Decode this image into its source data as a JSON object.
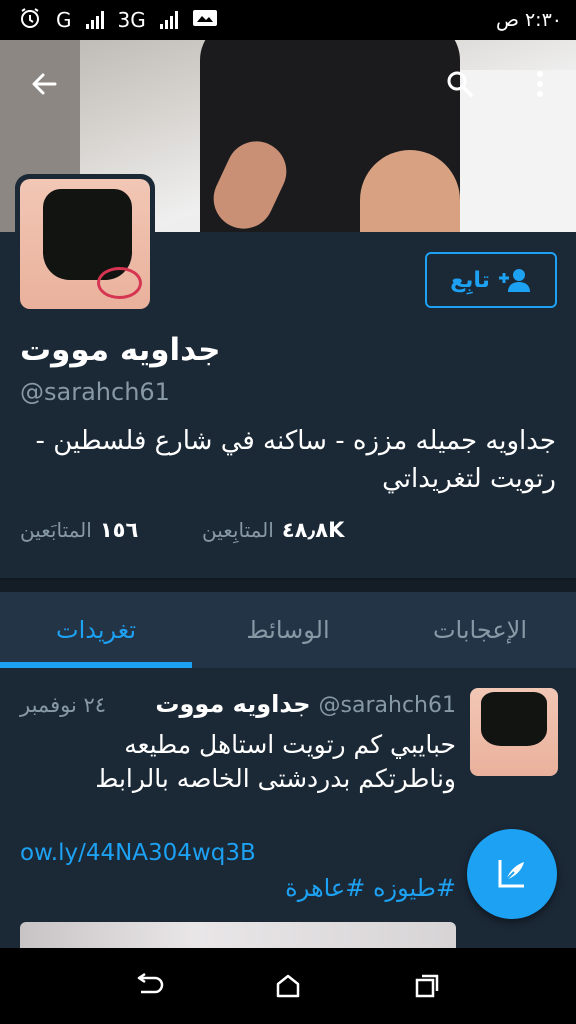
{
  "status_bar": {
    "time": "٢:٣٠",
    "ampm": "ص",
    "network_1": "G",
    "network_2": "3G",
    "icons": [
      "alarm-icon",
      "signal-icon",
      "signal-icon",
      "screenshot-icon"
    ]
  },
  "header": {
    "back_icon": "back-arrow-icon",
    "search_icon": "search-icon",
    "menu_icon": "overflow-menu-icon"
  },
  "profile": {
    "follow_label": "تابِع",
    "follow_icon": "add-user-icon",
    "display_name": "جداويه مووت",
    "handle": "@sarahch61",
    "bio": "جداويه جميله مززه - ساكنه في شارع فلسطين - رتويت لتغريداتي",
    "stats": {
      "followers_value": "٤٨٫٨K",
      "followers_label": "المتابِعين",
      "following_value": "١٥٦",
      "following_label": "المتابَعين"
    }
  },
  "tabs": [
    {
      "label": "تغريدات",
      "active": true
    },
    {
      "label": "الوسائط",
      "active": false
    },
    {
      "label": "الإعجابات",
      "active": false
    }
  ],
  "tweet": {
    "author_name": "جداويه مووت",
    "author_handle": "@sarahch61",
    "time": "٢٤ نوفمبر",
    "text": "حبايبي كم رتويت استاهل مطيعه وناطرتكم بدردشتى الخاصه بالرابط",
    "link": "ow.ly/44NA304wq3B",
    "hashtags": "#طيوزه #عاهرة"
  },
  "compose": {
    "icon": "compose-tweet-icon"
  },
  "nav_bar": {
    "icons": [
      "back-icon",
      "home-icon",
      "recents-icon"
    ]
  },
  "colors": {
    "background": "#1b2836",
    "accent": "#1da1f2",
    "muted_text": "#8899a6",
    "tab_bar": "#243447"
  }
}
